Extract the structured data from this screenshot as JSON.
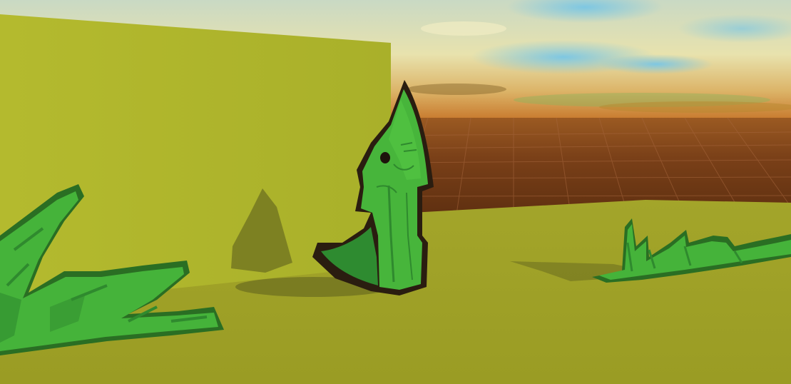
{
  "scene": {
    "ui_text": [],
    "palette": {
      "sky_blue": "#7fc6df",
      "sky_cream": "#efe7b0",
      "horizon_orange": "#c87a2a",
      "ground_brown": "#6e3815",
      "grid_line": "#a0603a",
      "wall_yellow": "#adb52e",
      "floor_olive": "#9ea12a",
      "shadow": "#6f7021",
      "foliage_green": "#45b33a",
      "foliage_dark": "#2f8a2e",
      "outline": "#2a1d10"
    },
    "objects": [
      "sky",
      "sun-clouds",
      "grid-ground",
      "yellow-wall",
      "olive-floor",
      "green-dino-character",
      "grass-left",
      "grass-right"
    ]
  }
}
